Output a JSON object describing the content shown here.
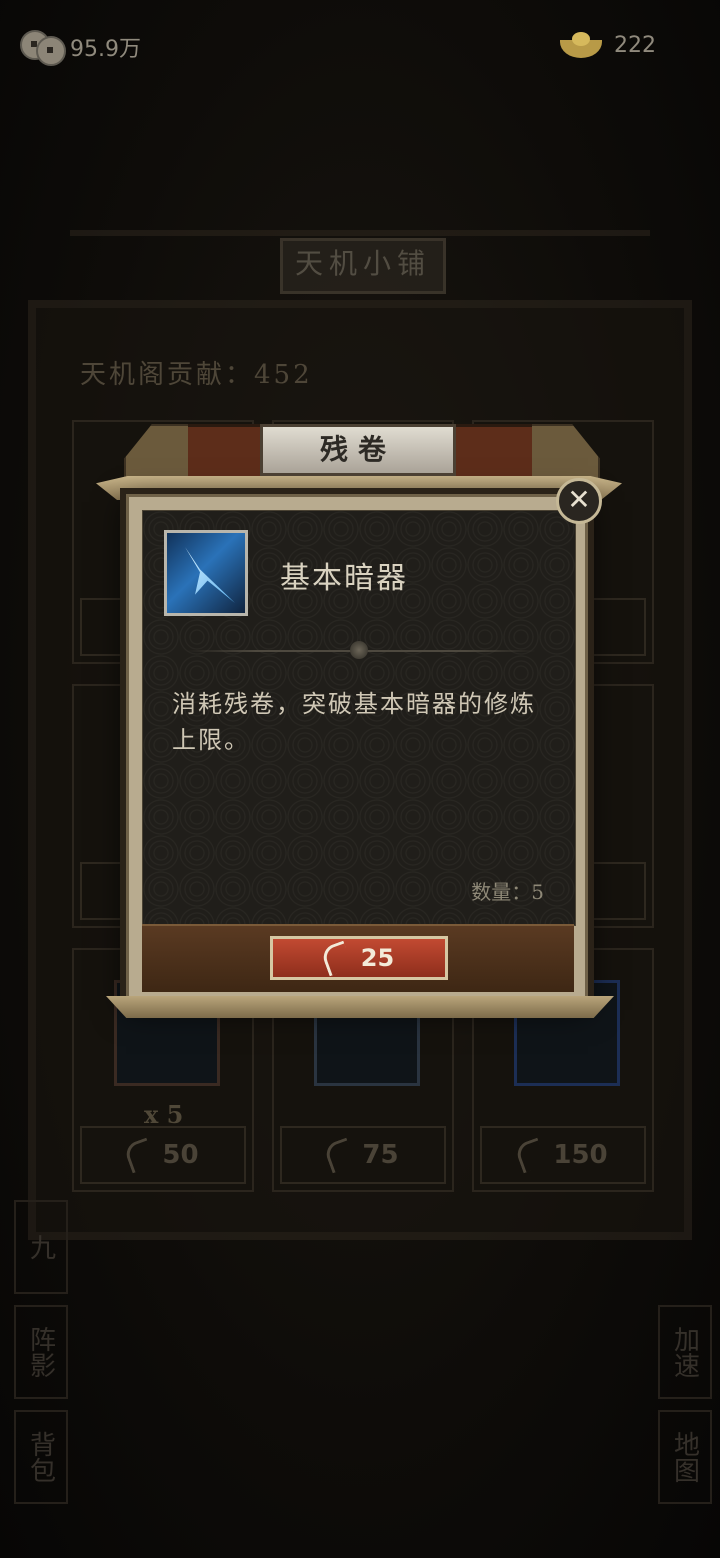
{
  "currency": {
    "coins": "95.9万",
    "ingots": "222"
  },
  "shop": {
    "title": "天机小铺",
    "contribution": "天机阁贡献：452",
    "items": [
      {
        "qty": "x 5",
        "price": "50"
      },
      {
        "qty": "",
        "price": "75"
      },
      {
        "qty": "",
        "price": "150"
      }
    ],
    "side_left": [
      "九",
      "阵影",
      "背包"
    ],
    "side_right": [
      "加速",
      "地图"
    ]
  },
  "dialog": {
    "title": "残卷",
    "item_name": "基本暗器",
    "description": "消耗残卷，突破基本暗器的修炼上限。",
    "count_label": "数量：5",
    "price": "25",
    "close_glyph": "✕"
  }
}
